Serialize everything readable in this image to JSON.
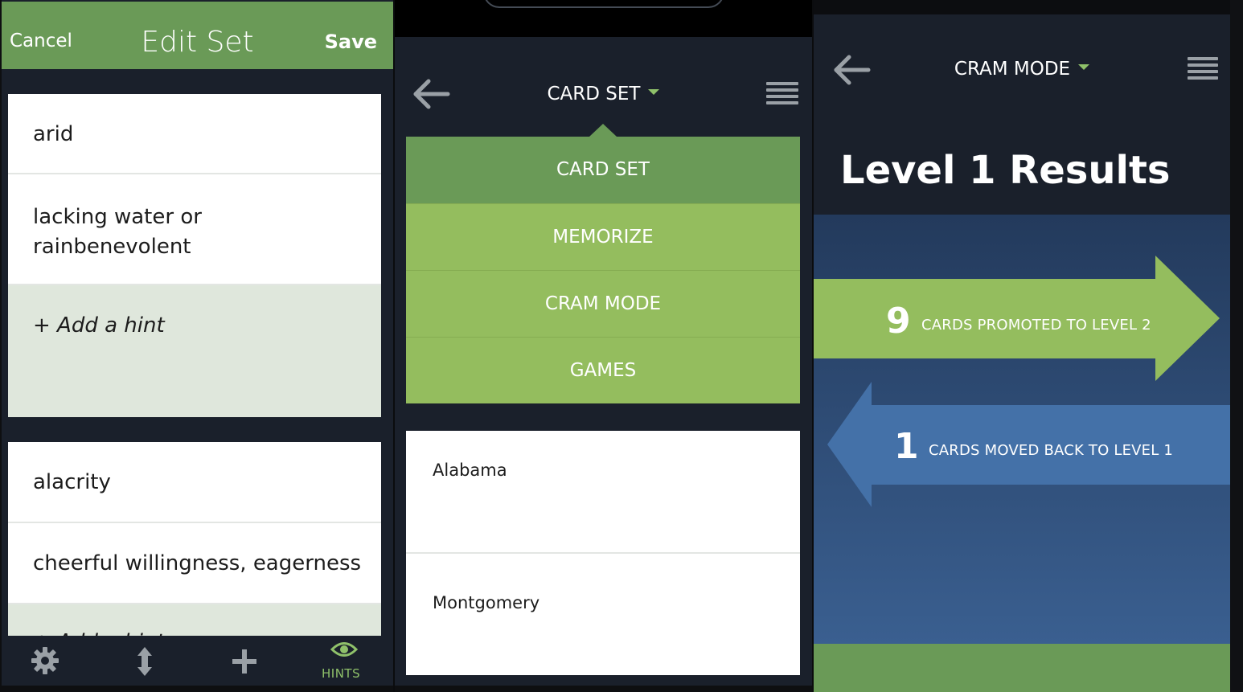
{
  "edit_set": {
    "cancel_label": "Cancel",
    "title": "Edit Set",
    "save_label": "Save",
    "cards": [
      {
        "term": "arid",
        "definition": "lacking water or rainbenevolent",
        "definition_line1": "lacking water or",
        "definition_line2": "rainbenevolent",
        "hint_label": "+ Add a hint"
      },
      {
        "term": "alacrity",
        "definition": "cheerful willingness, eagerness",
        "hint_label": "+ Add a hint"
      }
    ],
    "bottom_bar": {
      "icons": [
        "gear-icon",
        "reorder-icon",
        "plus-icon",
        "eye-icon"
      ],
      "hints_label": "HINTS"
    },
    "colors": {
      "header": "#6a9a57",
      "hint_bg": "#dfe7dc",
      "accent": "#8fc16a"
    }
  },
  "card_set": {
    "header_title": "CARD SET",
    "menu": [
      "CARD SET",
      "MEMORIZE",
      "CRAM MODE",
      "GAMES"
    ],
    "cards": [
      {
        "front": "Alabama"
      },
      {
        "back": "Montgomery"
      }
    ],
    "colors": {
      "menu_active": "#6a9a57",
      "menu_item": "#94bd5e"
    }
  },
  "cram_mode": {
    "header_title": "CRAM MODE",
    "results_title": "Level 1 Results",
    "promoted": {
      "count": "9",
      "text": "CARDS PROMOTED TO LEVEL 2"
    },
    "moved_back": {
      "count": "1",
      "text": "CARDS MOVED BACK TO LEVEL 1"
    },
    "colors": {
      "promote_arrow": "#94bd5e",
      "back_arrow": "#4471a8",
      "bg_top": "#233a5c"
    }
  }
}
